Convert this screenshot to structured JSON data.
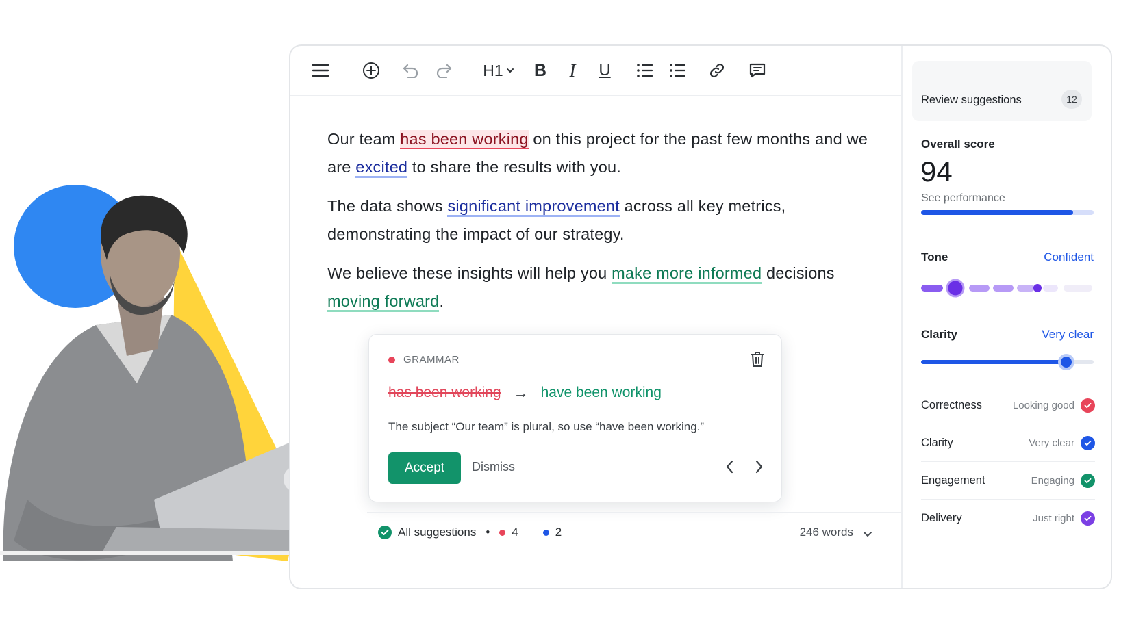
{
  "toolbar": {
    "heading_label": "H1",
    "bold_label": "B",
    "italic_label": "I",
    "underline_label": "U"
  },
  "document": {
    "p1": {
      "t1": "Our team ",
      "h1": "has been working",
      "t2": " on this project for the past few months and we are ",
      "h2": "excited",
      "t3": " to share the results with you."
    },
    "p2": {
      "t1": "The data shows ",
      "h1": "significant improvement",
      "t2": " across all key metrics, demonstrating the impact of our strategy."
    },
    "p3": {
      "t1": "We believe these insights will help you ",
      "h1": "make more informed",
      "t2": " decisions ",
      "h2": "moving forward",
      "t3": "."
    }
  },
  "suggestion_card": {
    "category": "GRAMMAR",
    "original": "has been working",
    "arrow": "→",
    "replacement": "have been working",
    "explanation": "The subject “Our team” is plural, so use “have been working.”",
    "accept_label": "Accept",
    "dismiss_label": "Dismiss"
  },
  "status_bar": {
    "all_label": "All suggestions",
    "separator": "•",
    "red_count": "4",
    "blue_count": "2",
    "word_count": "246 words"
  },
  "panel": {
    "review": {
      "label": "Review suggestions",
      "count": "12"
    },
    "overall": {
      "title": "Overall score",
      "score": "94",
      "link": "See performance",
      "progress": 0.88
    },
    "tone": {
      "title": "Tone",
      "value": "Confident"
    },
    "clarity": {
      "title": "Clarity",
      "value": "Very clear",
      "level": 0.84
    },
    "metrics": [
      {
        "name": "Correctness",
        "value": "Looking good",
        "color": "#e8455a"
      },
      {
        "name": "Clarity",
        "value": "Very clear",
        "color": "#1e56e6"
      },
      {
        "name": "Engagement",
        "value": "Engaging",
        "color": "#12936a"
      },
      {
        "name": "Delivery",
        "value": "Just right",
        "color": "#7b3fe4"
      }
    ]
  },
  "colors": {
    "accent_blue": "#1e56e6",
    "accent_green": "#12936a",
    "accent_red": "#e8455a",
    "accent_purple": "#7b3fe4",
    "illustration_blue": "#2f87f2",
    "illustration_yellow": "#ffd43b"
  }
}
